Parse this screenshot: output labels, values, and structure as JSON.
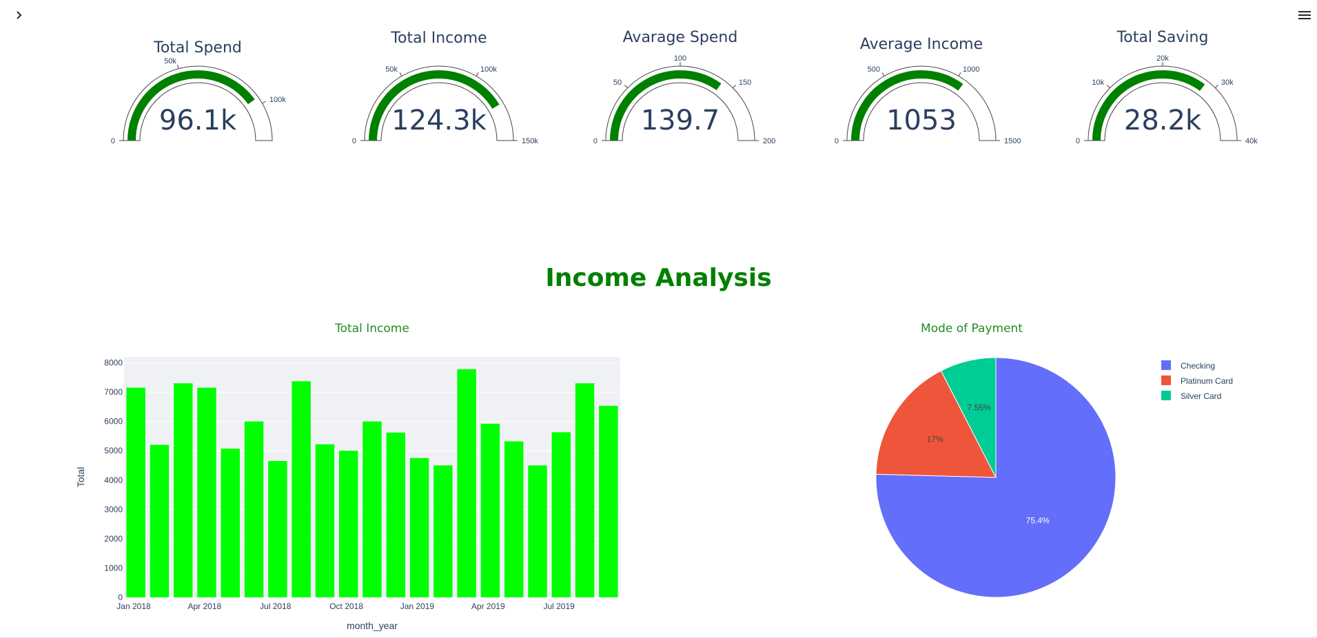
{
  "icons": {
    "expand": "chevron-right-icon",
    "menu": "hamburger-menu-icon"
  },
  "colors": {
    "gauge_bar": "#008000",
    "section_title": "#008000",
    "chart_title": "#228b22",
    "bar_fill": "#00ff00",
    "plot_bg": "#f0f1f5",
    "pie": [
      "#636efa",
      "#ef553b",
      "#00cc96"
    ]
  },
  "gauges": [
    {
      "title": "Total Spend",
      "value": 96.1,
      "display": "96.1k",
      "max": 120,
      "ticks": [
        "0",
        "50k",
        "100k"
      ],
      "tick_values": [
        0,
        50,
        100
      ]
    },
    {
      "title": "Total Income",
      "value": 124.3,
      "display": "124.3k",
      "max": 150,
      "ticks": [
        "0",
        "50k",
        "100k",
        "150k"
      ],
      "tick_values": [
        0,
        50,
        100,
        150
      ]
    },
    {
      "title": "Avarage Spend",
      "value": 139.7,
      "display": "139.7",
      "max": 200,
      "ticks": [
        "0",
        "50",
        "100",
        "150",
        "200"
      ],
      "tick_values": [
        0,
        50,
        100,
        150,
        200
      ]
    },
    {
      "title": "Average Income",
      "value": 1053,
      "display": "1053",
      "max": 1500,
      "ticks": [
        "0",
        "500",
        "1000",
        "1500"
      ],
      "tick_values": [
        0,
        500,
        1000,
        1500
      ]
    },
    {
      "title": "Total Saving",
      "value": 28.2,
      "display": "28.2k",
      "max": 40,
      "ticks": [
        "0",
        "10k",
        "20k",
        "30k",
        "40k"
      ],
      "tick_values": [
        0,
        10,
        20,
        30,
        40
      ]
    }
  ],
  "section": {
    "title": "Income Analysis"
  },
  "chart_data": [
    {
      "type": "bar",
      "title": "Total Income",
      "xlabel": "month_year",
      "ylabel": "Total",
      "categories": [
        "2018-01",
        "2018-02",
        "2018-03",
        "2018-04",
        "2018-05",
        "2018-06",
        "2018-07",
        "2018-08",
        "2018-09",
        "2018-10",
        "2018-11",
        "2018-12",
        "2019-01",
        "2019-02",
        "2019-03",
        "2019-04",
        "2019-05",
        "2019-06",
        "2019-07",
        "2019-08",
        "2019-09"
      ],
      "values": [
        7150,
        5200,
        7300,
        7150,
        5070,
        6000,
        4650,
        7370,
        5220,
        5000,
        6000,
        5620,
        4750,
        4500,
        7780,
        5920,
        5320,
        4500,
        5630,
        7300,
        6530
      ],
      "ylim": [
        0,
        8200
      ],
      "yticks": [
        0,
        1000,
        2000,
        3000,
        4000,
        5000,
        6000,
        7000,
        8000
      ],
      "xticks": [
        {
          "at": "2018-01",
          "label": "Jan 2018"
        },
        {
          "at": "2018-04",
          "label": "Apr 2018"
        },
        {
          "at": "2018-07",
          "label": "Jul 2018"
        },
        {
          "at": "2018-10",
          "label": "Oct 2018"
        },
        {
          "at": "2019-01",
          "label": "Jan 2019"
        },
        {
          "at": "2019-04",
          "label": "Apr 2019"
        },
        {
          "at": "2019-07",
          "label": "Jul 2019"
        }
      ]
    },
    {
      "type": "pie",
      "title": "Mode of Payment",
      "labels": [
        "Checking",
        "Platinum Card",
        "Silver Card"
      ],
      "values": [
        75.4,
        17,
        7.55
      ],
      "text": [
        "75.4%",
        "17%",
        "7.55%"
      ],
      "legend": "top-right"
    }
  ]
}
